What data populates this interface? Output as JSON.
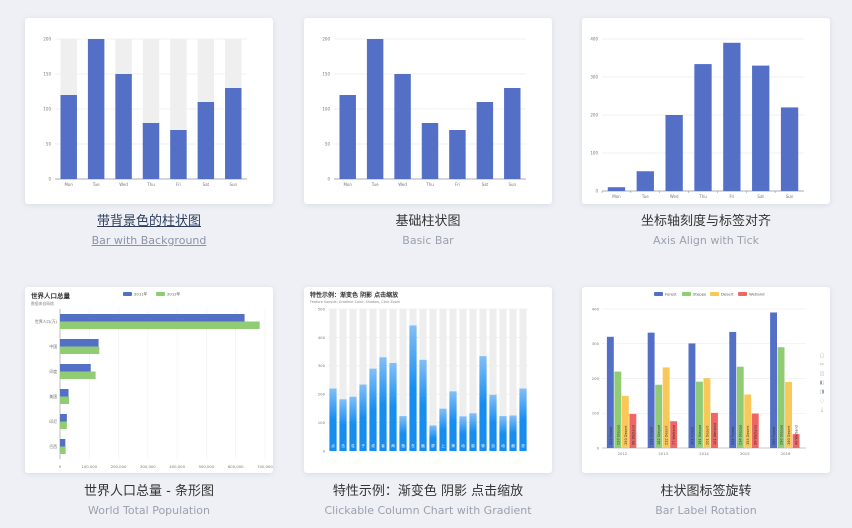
{
  "colors": {
    "bar": "#5470c6",
    "green": "#91cc75",
    "yellow": "#fac858",
    "red": "#ee6666",
    "bg": "#efefef",
    "gradTop": "#83bff6",
    "gradBot": "#188df0"
  },
  "cards": [
    {
      "title": "带背景色的柱状图",
      "subtitle": "Bar with Background"
    },
    {
      "title": "基础柱状图",
      "subtitle": "Basic Bar"
    },
    {
      "title": "坐标轴刻度与标签对齐",
      "subtitle": "Axis Align with Tick"
    },
    {
      "title": "世界人口总量 - 条形图",
      "subtitle": "World Total Population"
    },
    {
      "title": "特性示例：渐变色 阴影 点击缩放",
      "subtitle": "Clickable Column Chart with Gradient"
    },
    {
      "title": "柱状图标签旋转",
      "subtitle": "Bar Label Rotation"
    }
  ],
  "chart_data": [
    {
      "type": "bar",
      "categories": [
        "Mon",
        "Tue",
        "Wed",
        "Thu",
        "Fri",
        "Sat",
        "Sun"
      ],
      "values": [
        120,
        200,
        150,
        80,
        70,
        110,
        130
      ],
      "ylim": [
        0,
        200
      ],
      "yticks": [
        "0",
        "50",
        "100",
        "150",
        "200"
      ],
      "background": true
    },
    {
      "type": "bar",
      "categories": [
        "Mon",
        "Tue",
        "Wed",
        "Thu",
        "Fri",
        "Sat",
        "Sun"
      ],
      "values": [
        120,
        200,
        150,
        80,
        70,
        110,
        130
      ],
      "ylim": [
        0,
        200
      ],
      "yticks": [
        "0",
        "50",
        "100",
        "150",
        "200"
      ]
    },
    {
      "type": "bar",
      "categories": [
        "Mon",
        "Tue",
        "Wed",
        "Thu",
        "Fri",
        "Sat",
        "Sun"
      ],
      "values": [
        10,
        52,
        200,
        334,
        390,
        330,
        220
      ],
      "ylim": [
        0,
        400
      ],
      "yticks": [
        "0",
        "100",
        "200",
        "300",
        "400"
      ]
    },
    {
      "type": "bar",
      "orientation": "horizontal",
      "title": "世界人口总量",
      "subtitle": "数据来自网络",
      "legend": [
        "2011年",
        "2012年"
      ],
      "categories": [
        "巴西",
        "印尼",
        "美国",
        "印度",
        "中国",
        "世界人口(万)"
      ],
      "series": [
        {
          "name": "2011年",
          "values": [
            18203,
            23489,
            29034,
            104970,
            131744,
            630230
          ]
        },
        {
          "name": "2012年",
          "values": [
            19325,
            23438,
            31000,
            121594,
            134141,
            681807
          ]
        }
      ],
      "xticks": [
        "0",
        "100,000",
        "200,000",
        "300,000",
        "400,000",
        "500,000",
        "600,000",
        "700,000"
      ],
      "xlim": [
        0,
        700000
      ]
    },
    {
      "type": "bar",
      "title": "特性示例：渐变色 阴影 点击缩放",
      "subtitle": "Feature Sample: Gradient Color, Shadow, Click Zoom",
      "categories": [
        "点",
        "击",
        "柱",
        "子",
        "或",
        "者",
        "两",
        "指",
        "在",
        "触",
        "屏",
        "上",
        "滑",
        "动",
        "能",
        "够",
        "自",
        "动",
        "缩",
        "放"
      ],
      "values": [
        220,
        182,
        191,
        234,
        290,
        330,
        310,
        123,
        442,
        321,
        90,
        149,
        210,
        122,
        133,
        334,
        198,
        123,
        125,
        220
      ],
      "ylim": [
        0,
        500
      ],
      "yticks": [
        "0",
        "100",
        "200",
        "300",
        "400",
        "500"
      ]
    },
    {
      "type": "bar",
      "legend": [
        "Forest",
        "Steppe",
        "Desert",
        "Wetland"
      ],
      "categories": [
        "2012",
        "2013",
        "2014",
        "2015",
        "2016"
      ],
      "series": [
        {
          "name": "Forest",
          "values": [
            320,
            332,
            301,
            334,
            390
          ]
        },
        {
          "name": "Steppe",
          "values": [
            220,
            182,
            191,
            234,
            290
          ]
        },
        {
          "name": "Desert",
          "values": [
            150,
            232,
            201,
            154,
            190
          ]
        },
        {
          "name": "Wetland",
          "values": [
            98,
            77,
            101,
            99,
            40
          ]
        }
      ],
      "ylim": [
        0,
        400
      ],
      "yticks": [
        "0",
        "100",
        "200",
        "300",
        "400"
      ]
    }
  ]
}
